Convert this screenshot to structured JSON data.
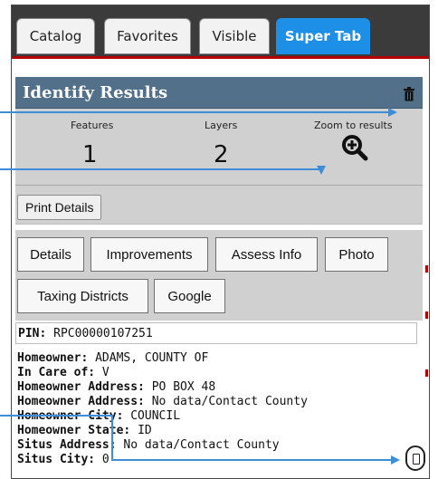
{
  "tabs": [
    {
      "label": "Catalog",
      "active": false
    },
    {
      "label": "Favorites",
      "active": false
    },
    {
      "label": "Visible",
      "active": false
    },
    {
      "label": "Super Tab",
      "active": true
    }
  ],
  "identify": {
    "title": "Identify Results",
    "features_label": "Features",
    "features_value": "1",
    "layers_label": "Layers",
    "layers_value": "2",
    "zoom_label": "Zoom to results"
  },
  "print_label": "Print Details",
  "subtabs": [
    "Details",
    "Improvements",
    "Assess Info",
    "Photo",
    "Taxing Districts",
    "Google"
  ],
  "pin": {
    "label": "PIN:",
    "value": "RPC00000107251"
  },
  "details": [
    {
      "label": "Homeowner:",
      "value": "ADAMS, COUNTY OF"
    },
    {
      "label": "In Care of:",
      "value": "V"
    },
    {
      "label": "Homeowner Address:",
      "value": "PO BOX 48"
    },
    {
      "label": "Homeowner Address:",
      "value": "No data/Contact County"
    },
    {
      "label": "Homeowner City:",
      "value": "COUNCIL"
    },
    {
      "label": "Homeowner State:",
      "value": "ID"
    },
    {
      "label": "Situs Address:",
      "value": "No data/Contact County"
    },
    {
      "label": "Situs City:",
      "value": "0"
    }
  ],
  "colors": {
    "accent": "#1e8fe6",
    "header": "#52708a",
    "arrow": "#3d8ed8"
  },
  "icons": {
    "trash": "trash-icon",
    "zoom": "zoom-magnifier-icon",
    "cursor": "click-icon"
  }
}
